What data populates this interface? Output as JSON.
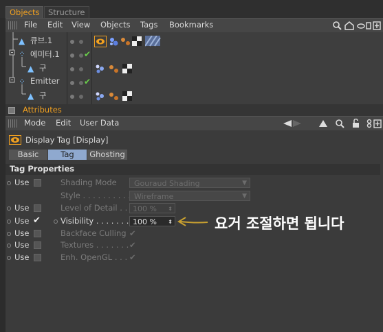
{
  "tabs": [
    "Objects",
    "Structure"
  ],
  "object_menu": [
    "File",
    "Edit",
    "View",
    "Objects",
    "Tags",
    "Bookmarks"
  ],
  "objects": [
    {
      "name": "큐브.1"
    },
    {
      "name": "에미터.1"
    },
    {
      "name": "구"
    },
    {
      "name": "Emitter"
    },
    {
      "name": "구"
    }
  ],
  "attributes_title": "Attributes",
  "attr_menu": [
    "Mode",
    "Edit",
    "User Data"
  ],
  "tag_title": "Display Tag [Display]",
  "subtabs": [
    "Basic",
    "Tag",
    "Ghosting"
  ],
  "section": "Tag Properties",
  "use_label": "Use",
  "props": {
    "shading_mode": {
      "label": "Shading Mode",
      "value": "Gouraud Shading"
    },
    "style": {
      "label": "Style . . . . . . . . . .",
      "value": "Wireframe"
    },
    "lod": {
      "label": "Level of Detail . .",
      "value": "100 %"
    },
    "visibility": {
      "label": "Visibility . . . . . . . .",
      "value": "100 %"
    },
    "backface": {
      "label": "Backface Culling"
    },
    "textures": {
      "label": "Textures . . . . . . ."
    },
    "enh": {
      "label": "Enh. OpenGL . . ."
    }
  },
  "annotation": "요거 조절하면 됩니다",
  "colors": {
    "accent": "#f0a020",
    "annotation_arrow": "#c8a030",
    "check": "#6ad04a",
    "subtab_active": "#8fa9cf"
  }
}
